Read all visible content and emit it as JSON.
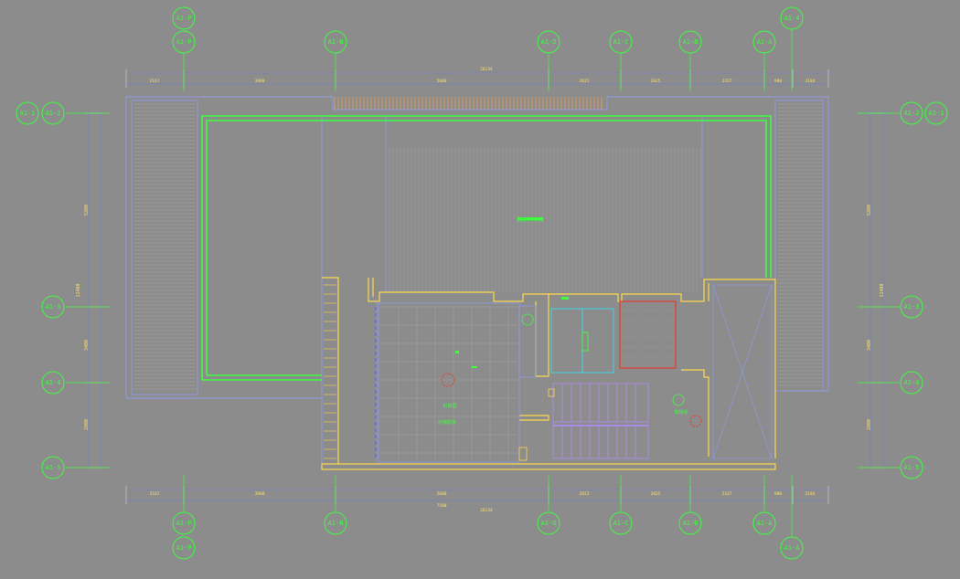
{
  "colors": {
    "background": "#8c8c8c",
    "grid_green": "#3cff3c",
    "wall_yellow": "#ffd84a",
    "blue_line": "#8f9be8",
    "cyan": "#39d8e6",
    "red": "#e43a2a",
    "violet": "#b48cff",
    "orange": "#f0a050",
    "pink": "#e98ad6",
    "hatch": "#a8a8a8"
  },
  "grid_bubbles": {
    "top_row_1": [
      "A1-P",
      "A1-4"
    ],
    "top_row_2": [
      "A1-P",
      "A1-N",
      "A1-D",
      "A1-C",
      "A1-B",
      "A1-A"
    ],
    "bottom_row_1": [
      "A1-P",
      "A1-N",
      "A1-D",
      "A1-C",
      "A1-B",
      "A1-A"
    ],
    "bottom_row_2": [
      "A1-P",
      "A1-A"
    ],
    "left": [
      "A1-1",
      "A1-2",
      "A1-3",
      "A1-4",
      "A1-5"
    ],
    "right": [
      "A1-2",
      "A1-1",
      "A1-3",
      "A1-4",
      "A1-5"
    ]
  },
  "dimensions": {
    "top_overall": "26134",
    "top_segments": [
      "2167",
      "3900",
      "5600",
      "2822",
      "2825",
      "2337",
      "980",
      "2184"
    ],
    "bottom_overall": "26134",
    "bottom_sub": "7500",
    "bottom_segments": [
      "2167",
      "3900",
      "5600",
      "2822",
      "2825",
      "2337",
      "980",
      "2184"
    ],
    "left_overall": "11400",
    "left_segments": [
      "5200",
      "3400",
      "2800"
    ],
    "right_overall": "11400",
    "right_segments": [
      "5200",
      "3400",
      "2800"
    ]
  },
  "room_labels": [
    "屋面排水坡度",
    "机房层",
    "电梯机房",
    "楼梯间"
  ]
}
